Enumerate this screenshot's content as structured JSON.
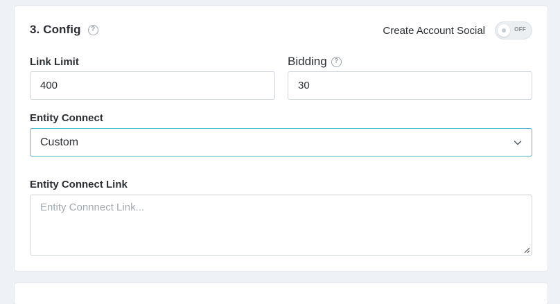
{
  "section": {
    "title": "3. Config",
    "help_icon": "question-circle-icon"
  },
  "toggle": {
    "label": "Create Account Social",
    "state_text": "OFF",
    "on": false
  },
  "link_limit": {
    "label": "Link Limit",
    "value": "400"
  },
  "bidding": {
    "label": "Bidding",
    "value": "30"
  },
  "entity_connect": {
    "label": "Entity Connect",
    "selected": "Custom",
    "accent_color": "#4fb6c4"
  },
  "entity_connect_link": {
    "label": "Entity Connect Link",
    "placeholder": "Entity Connnect Link...",
    "value": ""
  }
}
